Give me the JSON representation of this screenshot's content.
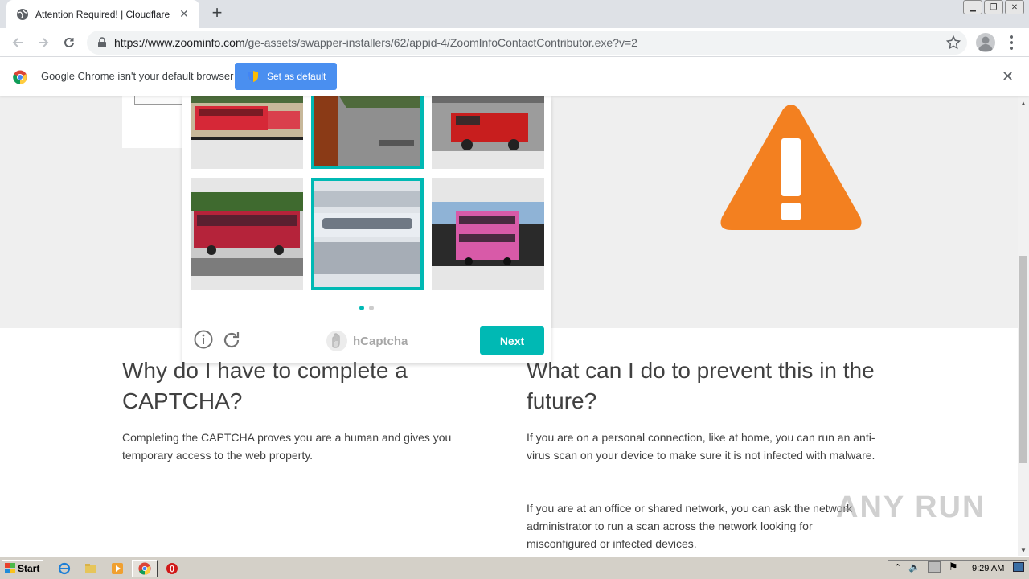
{
  "browser": {
    "tab_title": "Attention Required! | Cloudflare",
    "url_host": "https://www.zoominfo.com",
    "url_path": "/ge-assets/swapper-installers/62/appid-4/ZoomInfoContactContributor.exe?v=2"
  },
  "infobar": {
    "message": "Google Chrome isn't your default browser",
    "button_label": "Set as default"
  },
  "captcha": {
    "brand": "hCaptcha",
    "next_label": "Next",
    "cells": [
      {
        "selected": false
      },
      {
        "selected": true
      },
      {
        "selected": false
      },
      {
        "selected": false
      },
      {
        "selected": true
      },
      {
        "selected": false
      }
    ],
    "page_dots": 2,
    "active_dot": 1
  },
  "page": {
    "left_heading": "Why do I have to complete a CAPTCHA?",
    "left_text": "Completing the CAPTCHA proves you are a human and gives you temporary access to the web property.",
    "right_heading": "What can I do to prevent this in the future?",
    "right_text_1": "If you are on a personal connection, like at home, you can run an anti-virus scan on your device to make sure it is not infected with malware.",
    "right_text_2": "If you are at an office or shared network, you can ask the network administrator to run a scan across the network looking for misconfigured or infected devices."
  },
  "watermark": "ANY RUN",
  "taskbar": {
    "start_label": "Start",
    "clock": "9:29 AM"
  },
  "colors": {
    "accent": "#00b9b4",
    "warning": "#f38020",
    "set_default_button": "#4a8ff0"
  }
}
